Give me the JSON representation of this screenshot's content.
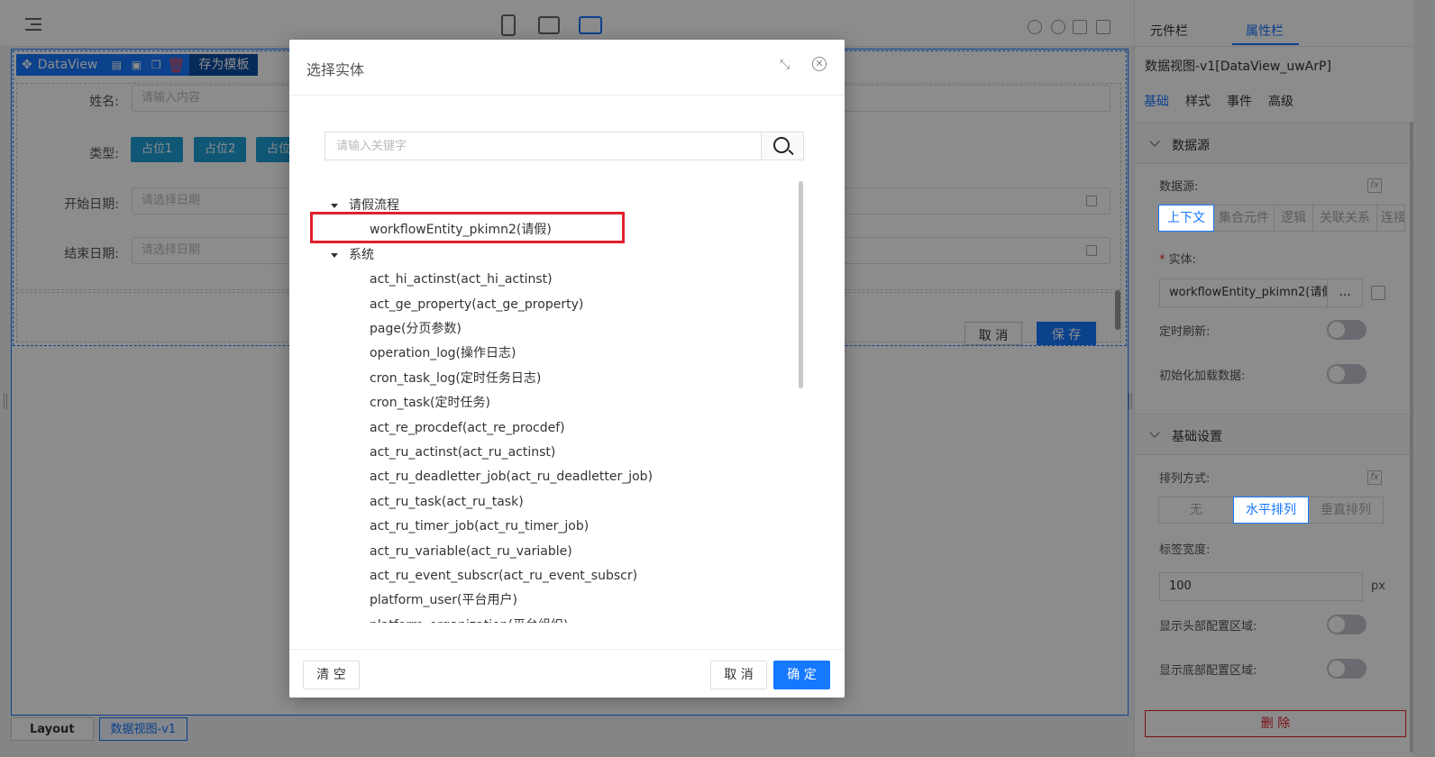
{
  "canvas": {
    "dataview_name": "DataView",
    "save_template": "存为模板",
    "form": {
      "name_label": "姓名:",
      "name_placeholder": "请输入内容",
      "type_label": "类型:",
      "chips": [
        "占位1",
        "占位2",
        "占位"
      ],
      "start_label": "开始日期:",
      "start_placeholder": "请选择日期",
      "end_label": "结束日期:",
      "end_placeholder": "请选择日期",
      "cancel": "取 消",
      "save": "保 存"
    },
    "breadcrumb": [
      "Layout",
      "数据视图-v1"
    ]
  },
  "modal": {
    "title": "选择实体",
    "search_placeholder": "请输入关键字",
    "tree": {
      "groups": [
        {
          "label": "请假流程",
          "items": [
            "workflowEntity_pkimn2(请假)"
          ]
        },
        {
          "label": "系统",
          "items": [
            "act_hi_actinst(act_hi_actinst)",
            "act_ge_property(act_ge_property)",
            "page(分页参数)",
            "operation_log(操作日志)",
            "cron_task_log(定时任务日志)",
            "cron_task(定时任务)",
            "act_re_procdef(act_re_procdef)",
            "act_ru_actinst(act_ru_actinst)",
            "act_ru_deadletter_job(act_ru_deadletter_job)",
            "act_ru_task(act_ru_task)",
            "act_ru_timer_job(act_ru_timer_job)",
            "act_ru_variable(act_ru_variable)",
            "act_ru_event_subscr(act_ru_event_subscr)",
            "platform_user(平台用户)",
            "platform_organization(平台组织)"
          ]
        }
      ]
    },
    "footer": {
      "clear": "清 空",
      "cancel": "取 消",
      "ok": "确 定"
    }
  },
  "right_panel": {
    "tabs": [
      "元件栏",
      "属性栏"
    ],
    "active_tab": "属性栏",
    "component_title": "数据视图-v1[DataView_uwArP]",
    "subtabs": [
      "基础",
      "样式",
      "事件",
      "高级"
    ],
    "active_subtab": "基础",
    "datasource_section": {
      "title": "数据源",
      "datasource_label": "数据源:",
      "datasource_options": [
        "上下文",
        "集合元件",
        "逻辑",
        "关联关系",
        "连接"
      ],
      "datasource_selected": "上下文",
      "entity_label": "实体:",
      "entity_value": "workflowEntity_pkimn2(请假)",
      "entity_more": "...",
      "timed_refresh_label": "定时刷新:",
      "init_load_label": "初始化加载数据:"
    },
    "basic_section": {
      "title": "基础设置",
      "layout_label": "排列方式:",
      "layout_options": [
        "无",
        "水平排列",
        "垂直排列"
      ],
      "layout_selected": "水平排列",
      "label_width_label": "标签宽度:",
      "label_width_value": "100",
      "label_width_unit": "px",
      "show_header_label": "显示头部配置区域:",
      "show_footer_label": "显示底部配置区域:"
    },
    "delete": "删 除"
  },
  "colors": {
    "accent": "#1677ff",
    "danger": "#e0202c",
    "chip": "#1e9fd8"
  }
}
